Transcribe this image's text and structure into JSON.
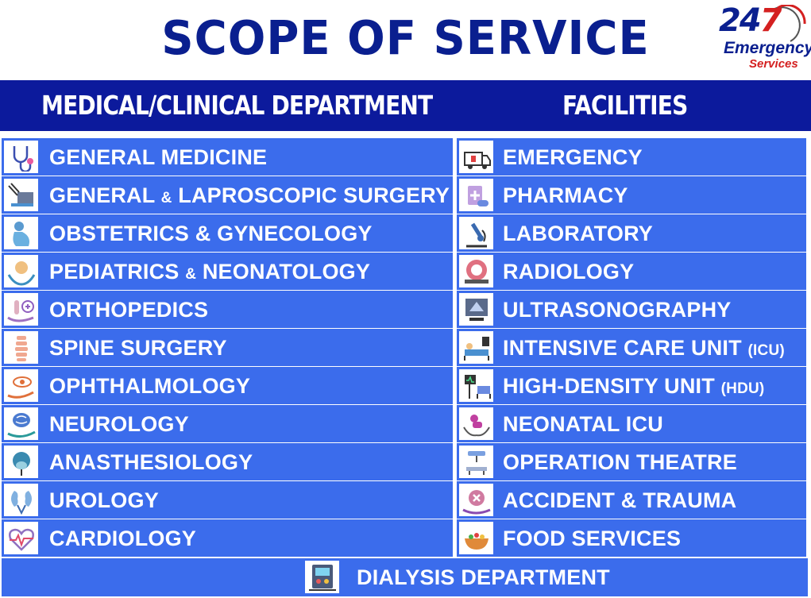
{
  "title": "SCOPE OF SERVICE",
  "logo": {
    "number": "24",
    "number_accent": "7",
    "line1": "Emergency",
    "line2": "Services"
  },
  "header": {
    "left": "MEDICAL/CLINICAL DEPARTMENT",
    "right": "FACILITIES"
  },
  "departments": [
    {
      "label": "GENERAL MEDICINE",
      "icon": "stethoscope-icon"
    },
    {
      "label": "GENERAL",
      "amp": "&",
      "label2": "LAPROSCOPIC SURGERY",
      "icon": "laparoscopy-icon"
    },
    {
      "label": "OBSTETRICS & GYNECOLOGY",
      "icon": "pregnancy-icon"
    },
    {
      "label": "PEDIATRICS",
      "amp": "&",
      "label2": "NEONATOLOGY",
      "icon": "baby-hands-icon"
    },
    {
      "label": "ORTHOPEDICS",
      "icon": "bone-hand-icon"
    },
    {
      "label": "SPINE SURGERY",
      "icon": "spine-icon"
    },
    {
      "label": "OPHTHALMOLOGY",
      "icon": "eye-hand-icon"
    },
    {
      "label": "NEUROLOGY",
      "icon": "brain-hand-icon"
    },
    {
      "label": "ANASTHESIOLOGY",
      "icon": "anesthesia-mask-icon"
    },
    {
      "label": "UROLOGY",
      "icon": "kidney-icon"
    },
    {
      "label": "CARDIOLOGY",
      "icon": "heart-pulse-icon"
    }
  ],
  "facilities": [
    {
      "label": "EMERGENCY",
      "icon": "ambulance-icon"
    },
    {
      "label": "PHARMACY",
      "icon": "pharmacy-icon"
    },
    {
      "label": "LABORATORY",
      "icon": "microscope-icon"
    },
    {
      "label": "RADIOLOGY",
      "icon": "ct-scanner-icon"
    },
    {
      "label": "ULTRASONOGRAPHY",
      "icon": "ultrasound-icon"
    },
    {
      "label": "INTENSIVE CARE UNIT",
      "suffix": "(ICU)",
      "icon": "icu-bed-icon"
    },
    {
      "label": "HIGH-DENSITY UNIT",
      "suffix": "(HDU)",
      "icon": "hdu-monitor-icon"
    },
    {
      "label": "NEONATAL ICU",
      "icon": "newborn-hands-icon"
    },
    {
      "label": "OPERATION THEATRE",
      "icon": "operating-lamp-icon"
    },
    {
      "label": "ACCIDENT & TRAUMA",
      "icon": "trauma-icon"
    },
    {
      "label": "FOOD SERVICES",
      "icon": "food-bowl-icon"
    }
  ],
  "dialysis": {
    "label": "DIALYSIS DEPARTMENT",
    "icon": "dialysis-machine-icon"
  },
  "colors": {
    "title": "#0a1f8f",
    "header_bg": "#0c1a9c",
    "row_bg": "#3b6cec",
    "accent_red": "#d42020"
  }
}
